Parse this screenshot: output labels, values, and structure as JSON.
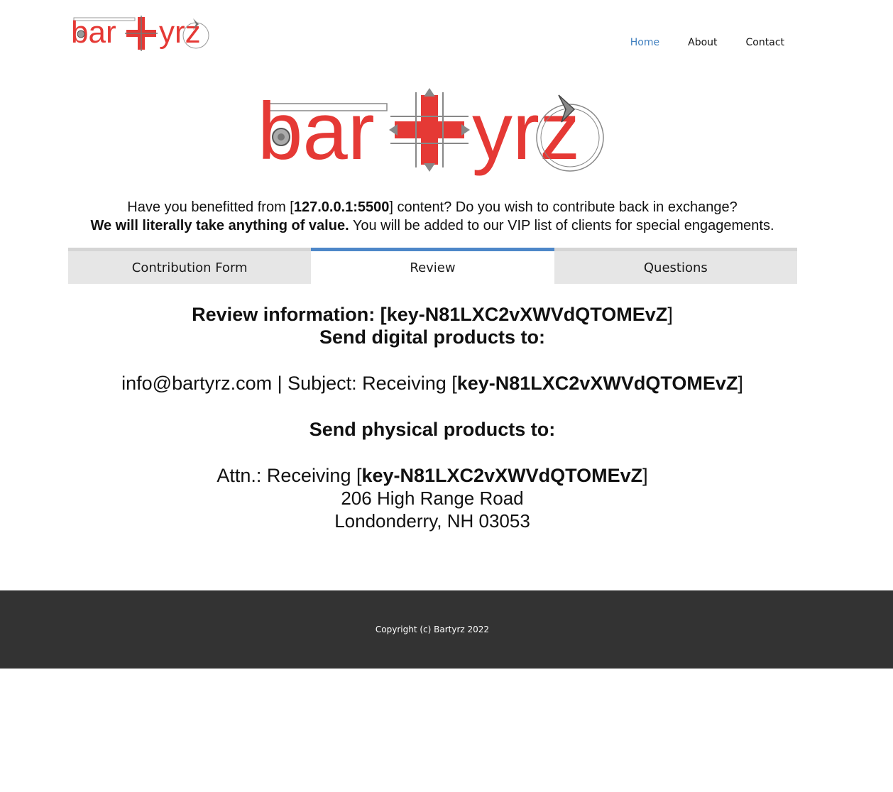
{
  "brand": {
    "name": "bartyrz",
    "letters_left": "bar",
    "letters_right": "yrz",
    "logo_red": "#e53935",
    "logo_grey": "#777777"
  },
  "nav": {
    "items": [
      "Home",
      "About",
      "Contact"
    ],
    "active": "Home",
    "active_color": "#3f7fbf"
  },
  "intro": {
    "line1_before": "Have you benefitted from [",
    "host": "127.0.0.1:5500",
    "line1_after": "] content? Do you wish to contribute back in exchange?",
    "line2_bold": "We will literally take anything of value.",
    "line2_rest": " You will be added to our VIP list of clients for special engagements."
  },
  "tabs": {
    "items": [
      "Contribution Form",
      "Review",
      "Questions"
    ],
    "active": "Review",
    "active_color": "#4d87c8"
  },
  "review": {
    "title_prefix": "Review information: [",
    "key": "key-N81LXC2vXWVdQTOMEvZ",
    "bracket_close": "]",
    "digital_heading": "Send digital products to:",
    "email_line": "info@bartyrz.com | Subject: Receiving [",
    "physical_heading": "Send physical products to:",
    "attn_prefix": "Attn.: Receiving [",
    "address_line1": "206 High Range Road",
    "address_line2": "Londonderry, NH 03053"
  },
  "footer": {
    "copyright": "Copyright (c) Bartyrz 2022",
    "background": "#333333"
  }
}
